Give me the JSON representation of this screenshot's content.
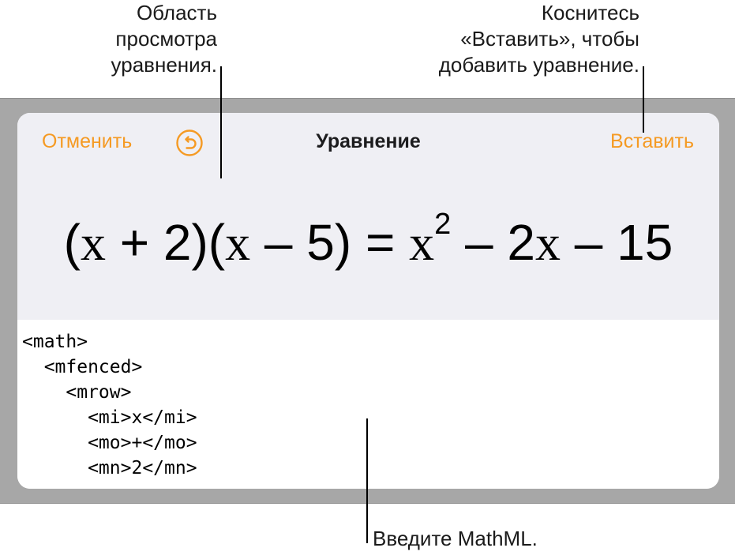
{
  "callouts": {
    "preview": "Область\nпросмотра\nуравнения.",
    "insert": "Коснитесь\n«Вставить», чтобы\nдобавить уравнение.",
    "mathml": "Введите MathML."
  },
  "toolbar": {
    "cancel_label": "Отменить",
    "title": "Уравнение",
    "insert_label": "Вставить",
    "undo_icon": "undo-icon"
  },
  "equation": {
    "p1": "(",
    "x1": "x",
    "p2": " + 2)(",
    "x2": "x",
    "p3": " – 5) = ",
    "x3": "x",
    "exp": "2",
    "p4": " – 2",
    "x4": "x",
    "p5": " – 15"
  },
  "editor": {
    "lines": [
      "<math>",
      "  <mfenced>",
      "    <mrow>",
      "      <mi>x</mi>",
      "      <mo>+</mo>",
      "      <mn>2</mn>"
    ]
  },
  "colors": {
    "accent": "#f59a23",
    "frame": "#a7a7a7",
    "preview_bg": "#efeff4"
  }
}
